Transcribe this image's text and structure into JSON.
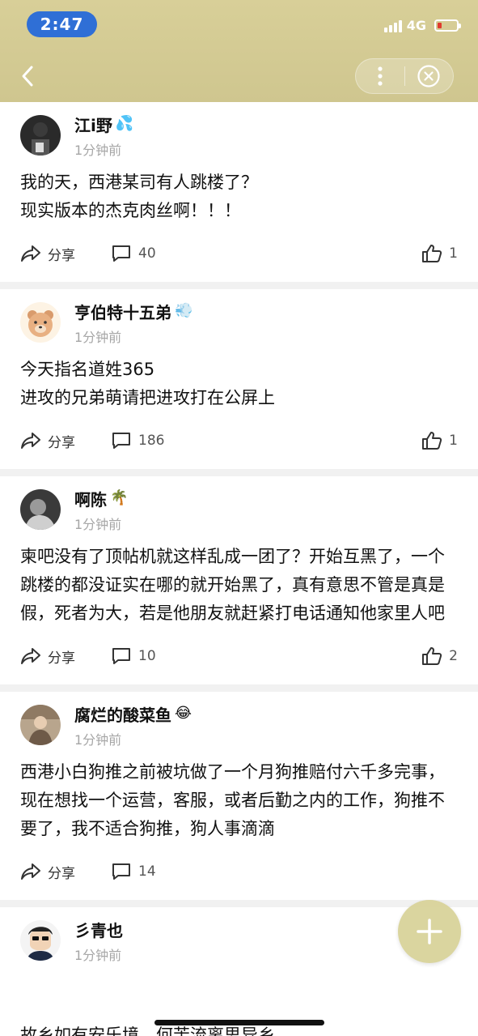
{
  "status_bar": {
    "time": "2:47",
    "network": "4G"
  },
  "header": {
    "back_icon": "chevron-left-icon",
    "more_icon": "more-vertical-icon",
    "close_icon": "close-circle-icon"
  },
  "colors": {
    "header_bg": "#d6cd95",
    "time_pill": "#2f6fd6",
    "fab": "#d9d39a",
    "muted": "#a6a6a6"
  },
  "posts": [
    {
      "name": "江i野",
      "emoji": "💦",
      "time": "1分钟前",
      "content": "我的天，西港某司有人跳楼了？\n现实版本的杰克肉丝啊！！！",
      "share_label": "分享",
      "comments": "40",
      "likes": "1"
    },
    {
      "name": "亨伯特十五弟",
      "emoji": "💨",
      "time": "1分钟前",
      "content": "今天指名道姓365\n进攻的兄弟萌请把进攻打在公屏上",
      "share_label": "分享",
      "comments": "186",
      "likes": "1"
    },
    {
      "name": "啊陈",
      "emoji": "🌴",
      "time": "1分钟前",
      "content": "柬吧没有了顶帖机就这样乱成一团了？开始互黑了，一个跳楼的都没证实在哪的就开始黑了，真有意思不管是真是假，死者为大，若是他朋友就赶紧打电话通知他家里人吧",
      "share_label": "分享",
      "comments": "10",
      "likes": "2"
    },
    {
      "name": "腐烂的酸菜鱼",
      "emoji": "😂",
      "time": "1分钟前",
      "content": "西港小白狗推之前被坑做了一个月狗推赔付六千多完事，现在想找一个运营，客服，或者后勤之内的工作，狗推不要了，我不适合狗推，狗人事滴滴",
      "share_label": "分享",
      "comments": "14",
      "likes": ""
    },
    {
      "name": "彡青也",
      "emoji": "",
      "time": "1分钟前",
      "content": "故乡如有安乐境，何苦流离思异乡"
    }
  ]
}
